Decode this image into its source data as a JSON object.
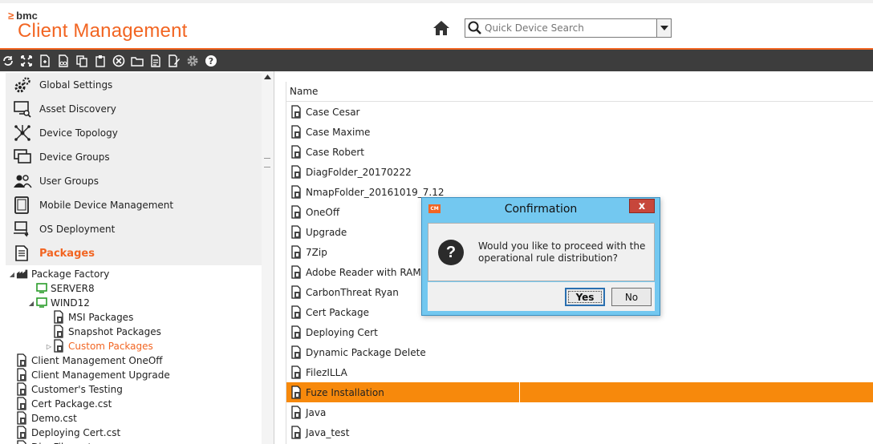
{
  "header": {
    "brand_mark": "≥",
    "brand": "bmc",
    "product": "Client Management",
    "search_placeholder": "Quick Device Search"
  },
  "colors": {
    "accent": "#f26522",
    "toolbar": "#3d3d3d",
    "selection": "#f7890c",
    "dialog_frame": "#73c8f0"
  },
  "nav": {
    "items": [
      {
        "label": "Global Settings",
        "icon": "gears-icon"
      },
      {
        "label": "Asset Discovery",
        "icon": "monitor-search-icon"
      },
      {
        "label": "Device Topology",
        "icon": "topology-icon"
      },
      {
        "label": "Device Groups",
        "icon": "device-group-icon"
      },
      {
        "label": "User Groups",
        "icon": "user-group-icon"
      },
      {
        "label": "Mobile Device Management",
        "icon": "mobile-device-icon"
      },
      {
        "label": "OS Deployment",
        "icon": "os-deployment-icon"
      },
      {
        "label": "Packages",
        "icon": "packages-icon"
      }
    ]
  },
  "tree": {
    "items": [
      {
        "label": "Package Factory",
        "level": 0,
        "exp": "◢"
      },
      {
        "label": "SERVER8",
        "level": 1,
        "exp": ""
      },
      {
        "label": "WIND12",
        "level": 1,
        "exp": "◢"
      },
      {
        "label": "MSI Packages",
        "level": 2,
        "exp": ""
      },
      {
        "label": "Snapshot Packages",
        "level": 2,
        "exp": ""
      },
      {
        "label": "Custom Packages",
        "level": 2,
        "exp": "▷"
      },
      {
        "label": "Client Management OneOff",
        "level": 0,
        "exp": ""
      },
      {
        "label": "Client Management Upgrade",
        "level": 0,
        "exp": ""
      },
      {
        "label": "Customer's Testing",
        "level": 0,
        "exp": ""
      },
      {
        "label": "Cert Package.cst",
        "level": 0,
        "exp": ""
      },
      {
        "label": "Demo.cst",
        "level": 0,
        "exp": ""
      },
      {
        "label": "Deploying Cert.cst",
        "level": 0,
        "exp": ""
      },
      {
        "label": "DiagFiles.cst",
        "level": 0,
        "exp": ""
      }
    ]
  },
  "list": {
    "column": "Name",
    "rows": [
      "Case Cesar",
      "Case Maxime",
      "Case Robert",
      "DiagFolder_20170222",
      "NmapFolder_20161019_7.12",
      "OneOff",
      "Upgrade",
      "7Zip",
      "Adobe Reader with RAM r",
      "CarbonThreat Ryan",
      "Cert Package",
      "Deploying Cert",
      "Dynamic Package Delete",
      "FilezILLA",
      "Fuze Installation",
      "Java",
      "Java_test"
    ]
  },
  "dialog": {
    "app_badge": "CM",
    "title": "Confirmation",
    "close": "x",
    "icon": "?",
    "message": "Would you like to proceed with the operational rule distribution?",
    "yes": "Yes",
    "no": "No"
  }
}
